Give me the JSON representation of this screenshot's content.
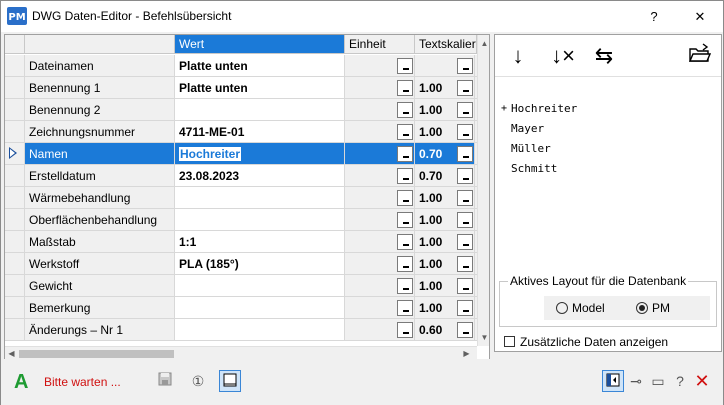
{
  "window": {
    "title": "DWG Daten-Editor - Befehlsübersicht",
    "help_label": "?",
    "close_label": "✕"
  },
  "grid": {
    "headers": {
      "value": "Wert",
      "unit": "Einheit",
      "text": "Textskalier"
    },
    "rows": [
      {
        "name": "Dateinamen",
        "value": "Platte unten",
        "scale": ""
      },
      {
        "name": "Benennung 1",
        "value": "Platte unten",
        "scale": "1.00"
      },
      {
        "name": "Benennung 2",
        "value": "",
        "scale": "1.00"
      },
      {
        "name": "Zeichnungsnummer",
        "value": "4711-ME-01",
        "scale": "1.00"
      },
      {
        "name": "Namen",
        "value": "Hochreiter",
        "scale": "0.70"
      },
      {
        "name": "Erstelldatum",
        "value": "23.08.2023",
        "scale": "0.70"
      },
      {
        "name": "Wärmebehandlung",
        "value": "",
        "scale": "1.00"
      },
      {
        "name": "Oberflächenbehandlung",
        "value": "",
        "scale": "1.00"
      },
      {
        "name": "Maßstab",
        "value": "1:1",
        "scale": "1.00"
      },
      {
        "name": "Werkstoff",
        "value": "PLA (185°)",
        "scale": "1.00"
      },
      {
        "name": "Gewicht",
        "value": "",
        "scale": "1.00"
      },
      {
        "name": "Bemerkung",
        "value": "",
        "scale": "1.00"
      },
      {
        "name": "Änderungs – Nr 1",
        "value": "",
        "scale": "0.60"
      }
    ]
  },
  "names_list": [
    "Hochreiter",
    "Mayer",
    "Müller",
    "Schmitt"
  ],
  "layout_group": {
    "label": "Aktives Layout für die Datenbank",
    "options": [
      "Model",
      "PM"
    ],
    "selected": "PM"
  },
  "extra_data_checkbox": {
    "label": "Zusätzliche Daten anzeigen",
    "checked": false
  },
  "bottom_bar": {
    "brand_letter": "A",
    "status": "Bitte warten ..."
  },
  "colors": {
    "selection": "#1b7ad8",
    "status_red": "#d01010",
    "brand_green": "#1e9b32"
  }
}
